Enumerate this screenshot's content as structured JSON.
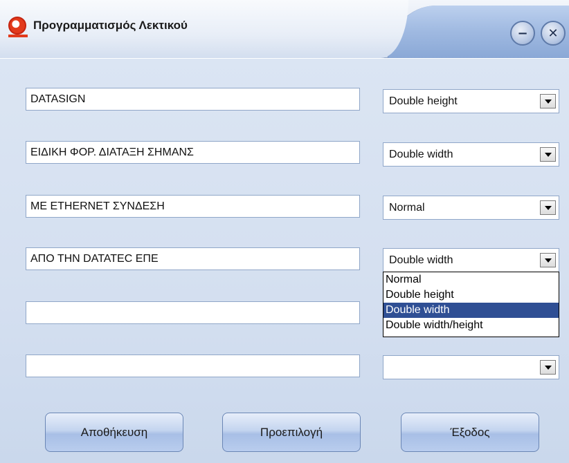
{
  "window": {
    "title": "Προγραμματισμός Λεκτικού",
    "minimize_symbol": "−",
    "close_symbol": "✕"
  },
  "rows": [
    {
      "text": "DATASIGN",
      "mode": "Double height"
    },
    {
      "text": "ΕΙΔΙΚΗ ΦΟΡ. ΔΙΑΤΑΞΗ ΣΗΜΑΝΣ",
      "mode": "Double width"
    },
    {
      "text": "ΜΕ ETHERNET ΣΥΝΔΕΣΗ",
      "mode": "Normal"
    },
    {
      "text": "ΑΠΟ ΤΗΝ DATATEC ΕΠΕ",
      "mode": "Double width"
    },
    {
      "text": "",
      "mode": ""
    },
    {
      "text": "",
      "mode": ""
    }
  ],
  "dropdown": {
    "open_for_row": 4,
    "options": [
      "Normal",
      "Double height",
      "Double width",
      "Double width/height"
    ],
    "selected": "Double width"
  },
  "buttons": {
    "save": "Αποθήκευση",
    "default": "Προεπιλογή",
    "exit": "Έξοδος"
  },
  "icons": {
    "app": "app-logo-icon",
    "minimize": "minimize-icon",
    "close": "close-icon",
    "dropdown_arrow": "chevron-down-icon"
  },
  "colors": {
    "selection": "#2f4f94",
    "client_background": "#d4dff0",
    "app_icon": "#e23a1c"
  }
}
